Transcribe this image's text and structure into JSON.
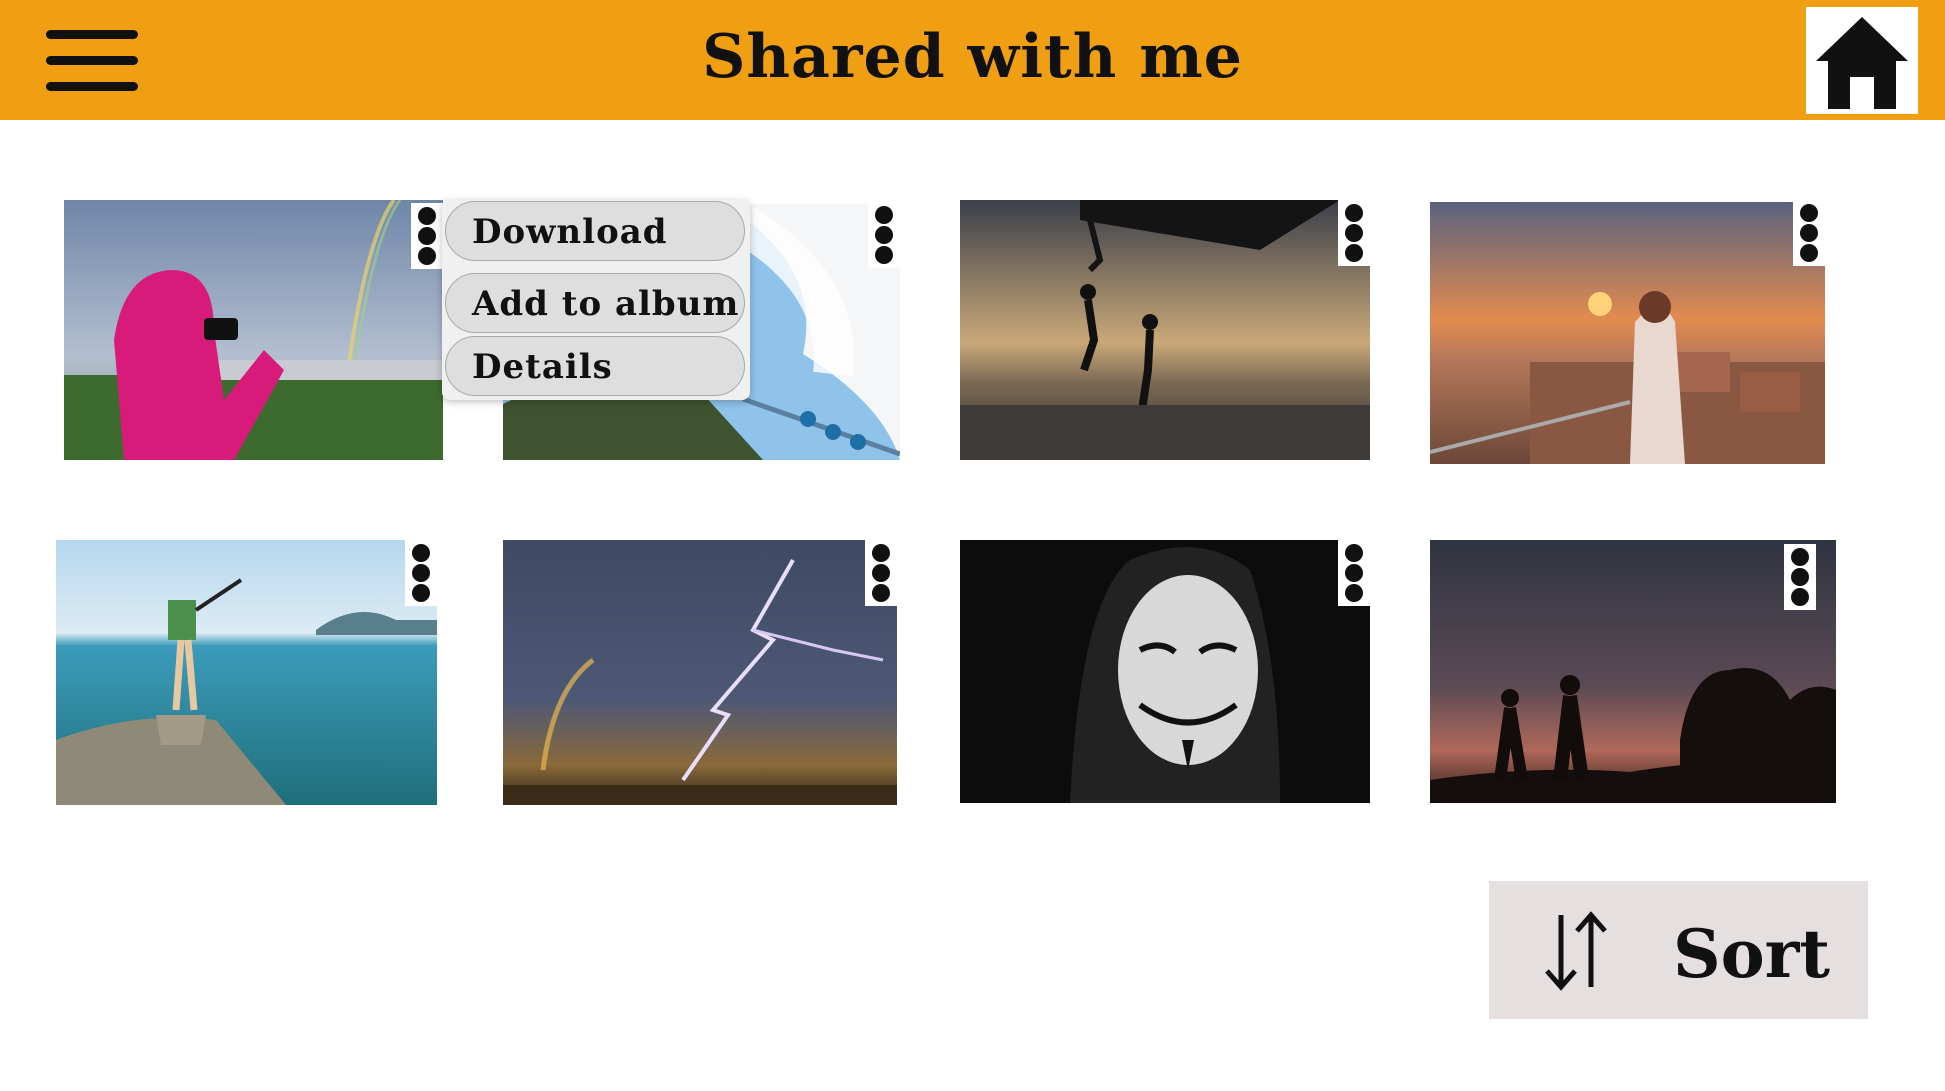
{
  "header": {
    "title": "Shared with me",
    "menu_icon": "hamburger-menu-icon",
    "home_icon": "home-icon",
    "accent_color": "#f09f12"
  },
  "photos": [
    {
      "subject": "woman in pink hoodie photographing a rainbow"
    },
    {
      "subject": "tourists near a waterfall spray"
    },
    {
      "subject": "people jumping into the sea at sunset"
    },
    {
      "subject": "woman leading by the hand over rooftops at sunset"
    },
    {
      "subject": "hiker with selfie stick on a seaside rock"
    },
    {
      "subject": "lightning storm with rainbow"
    },
    {
      "subject": "person wearing a Guy Fawkes mask"
    },
    {
      "subject": "couple silhouette at dusk"
    }
  ],
  "context_menu": {
    "items": [
      "Download",
      "Add to album",
      "Details"
    ]
  },
  "sort": {
    "label": "Sort",
    "icon": "sort-arrows-icon"
  }
}
